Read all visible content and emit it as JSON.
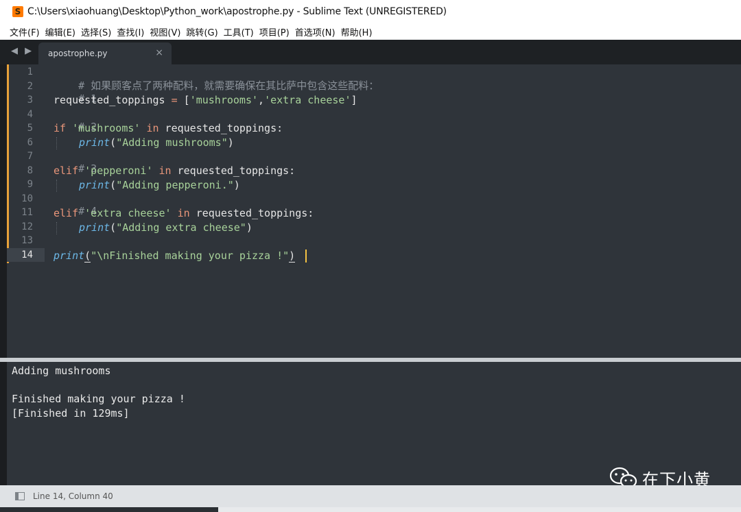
{
  "window": {
    "title": "C:\\Users\\xiaohuang\\Desktop\\Python_work\\apostrophe.py - Sublime Text (UNREGISTERED)",
    "icon": "sublime-text-icon"
  },
  "menu": {
    "items": [
      "文件(F)",
      "编辑(E)",
      "选择(S)",
      "查找(I)",
      "视图(V)",
      "跳转(G)",
      "工具(T)",
      "项目(P)",
      "首选项(N)",
      "帮助(H)"
    ]
  },
  "tabs": {
    "nav": "◀ ▶",
    "active": {
      "label": "apostrophe.py",
      "close": "×"
    }
  },
  "editor": {
    "line_numbers": [
      "1",
      "2",
      "3",
      "4",
      "5",
      "6",
      "7",
      "8",
      "9",
      "10",
      "11",
      "12",
      "13",
      "14"
    ],
    "current_line": 14,
    "code": {
      "l1": "# 如果顾客点了两种配料，就需要确保在其比萨中包含这些配料：",
      "l2": "# 1",
      "l3a": "requested_toppings ",
      "l3b": "=",
      "l3c": " [",
      "l3d": "'mushrooms'",
      "l3e": ",",
      "l3f": "'extra cheese'",
      "l3g": "]",
      "l4": "# 2",
      "l5a": "if",
      "l5b": " 'mushrooms'",
      "l5c": " in",
      "l5d": " requested_toppings:",
      "l6a": "print",
      "l6b": "(",
      "l6c": "\"Adding mushrooms\"",
      "l6d": ")",
      "l7": "# 3",
      "l8a": "elif",
      "l8b": " 'pepperoni'",
      "l8c": " in",
      "l8d": " requested_toppings:",
      "l9a": "print",
      "l9b": "(",
      "l9c": "\"Adding pepperoni.\"",
      "l9d": ")",
      "l10": "# 4",
      "l11a": "elif",
      "l11b": " 'extra cheese'",
      "l11c": " in",
      "l11d": " requested_toppings:",
      "l12a": "print",
      "l12b": "(",
      "l12c": "\"Adding extra cheese\"",
      "l12d": ")",
      "l13": "",
      "l14a": "print",
      "l14b": "(",
      "l14c": "\"\\nFinished making your pizza !\"",
      "l14d": ")"
    }
  },
  "output": {
    "lines": [
      "Adding mushrooms",
      "",
      "Finished making your pizza !",
      "[Finished in 129ms]"
    ]
  },
  "statusbar": {
    "position": "Line 14, Column 40"
  },
  "watermark": {
    "text": "在下小黄",
    "icon": "wechat-icon"
  },
  "colors": {
    "comment": "#8a9199",
    "keyword": "#e9967a",
    "string": "#a8d29a",
    "function": "#6cb7e6",
    "background": "#2f343a"
  }
}
